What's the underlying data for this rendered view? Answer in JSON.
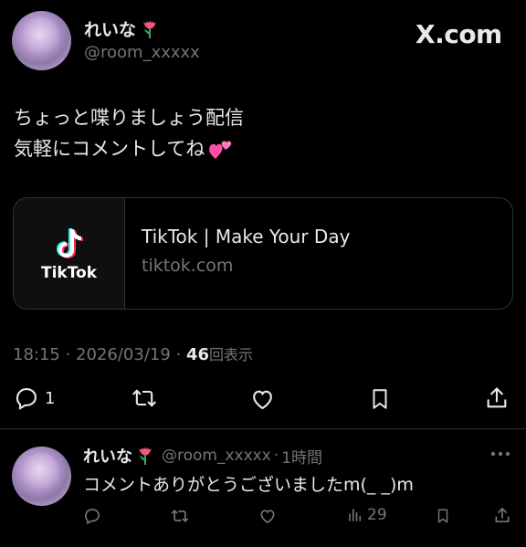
{
  "tweet": {
    "display_name": "れいな",
    "name_emoji": "tulip-emoji",
    "handle": "@room_xxxxx",
    "site_logo": "X.com",
    "text_line1": "ちょっと喋りましょう配信",
    "text_line2": "気軽にコメントしてね",
    "text_emoji": "two-hearts-emoji",
    "card": {
      "thumb_label": "TikTok",
      "title": "TikTok | Make Your Day",
      "domain": "tiktok.com"
    },
    "time": "18:15",
    "date": "2026/03/19",
    "views_count": "46",
    "views_label": "回表示",
    "reply_count": "1"
  },
  "reply": {
    "display_name": "れいな",
    "handle": "@room_xxxxx",
    "time_ago": "1時間",
    "text": "コメントありがとうございましたm(_ _)m",
    "views_count": "29"
  },
  "colors": {
    "background": "#000000",
    "text": "#e7e9ea",
    "muted": "#71767b",
    "border": "#2f3336",
    "tulip": "#f4577e",
    "heart": "#ff4fa3"
  }
}
